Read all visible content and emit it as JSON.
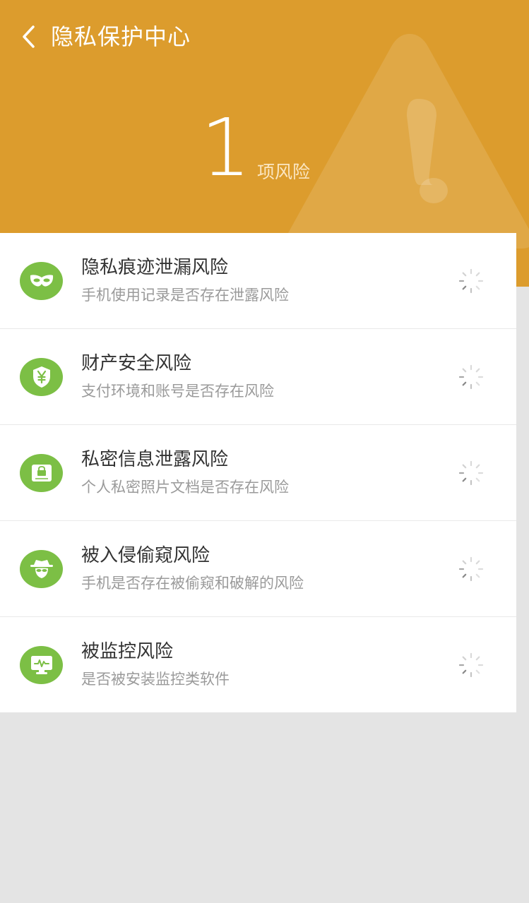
{
  "header": {
    "title": "隐私保护中心",
    "risk_count": "1",
    "risk_unit": "项风险"
  },
  "icons": {
    "back": "chevron-left-icon",
    "warning": "warning-triangle-icon",
    "loading": "loading-spinner-icon"
  },
  "colors": {
    "header_bg": "#dc9c2d",
    "icon_green": "#7cbf45",
    "page_bg": "#e4e4e4"
  },
  "items": [
    {
      "title": "隐私痕迹泄漏风险",
      "desc": "手机使用记录是否存在泄露风险",
      "icon": "mask-icon"
    },
    {
      "title": "财产安全风险",
      "desc": "支付环境和账号是否存在风险",
      "icon": "yen-shield-icon"
    },
    {
      "title": "私密信息泄露风险",
      "desc": "个人私密照片文档是否存在风险",
      "icon": "lock-document-icon"
    },
    {
      "title": "被入侵偷窥风险",
      "desc": "手机是否存在被偷窥和破解的风险",
      "icon": "spy-icon"
    },
    {
      "title": "被监控风险",
      "desc": "是否被安装监控类软件",
      "icon": "monitor-icon"
    }
  ]
}
